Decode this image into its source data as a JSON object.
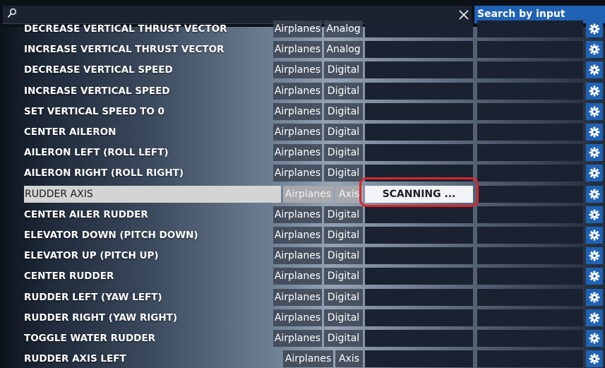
{
  "search": {
    "value": "",
    "placeholder": ""
  },
  "search_by_input_label": "Search by input",
  "rows": [
    {
      "name": "DECREASE VERTICAL THRUST VECTOR",
      "category": "Airplanes",
      "type": "Analog"
    },
    {
      "name": "INCREASE VERTICAL THRUST VECTOR",
      "category": "Airplanes",
      "type": "Analog"
    },
    {
      "name": "DECREASE VERTICAL SPEED",
      "category": "Airplanes",
      "type": "Digital"
    },
    {
      "name": "INCREASE VERTICAL SPEED",
      "category": "Airplanes",
      "type": "Digital"
    },
    {
      "name": "SET VERTICAL SPEED TO 0",
      "category": "Airplanes",
      "type": "Digital"
    },
    {
      "name": "CENTER AILERON",
      "category": "Airplanes",
      "type": "Digital"
    },
    {
      "name": "AILERON LEFT (ROLL LEFT)",
      "category": "Airplanes",
      "type": "Digital"
    },
    {
      "name": "AILERON RIGHT (ROLL RIGHT)",
      "category": "Airplanes",
      "type": "Digital"
    },
    {
      "name": "RUDDER AXIS",
      "category": "Airplanes",
      "type": "Axis",
      "binding": "SCANNING ..."
    },
    {
      "name": "CENTER AILER RUDDER",
      "category": "Airplanes",
      "type": "Digital"
    },
    {
      "name": "ELEVATOR DOWN (PITCH DOWN)",
      "category": "Airplanes",
      "type": "Digital"
    },
    {
      "name": "ELEVATOR UP (PITCH UP)",
      "category": "Airplanes",
      "type": "Digital"
    },
    {
      "name": "CENTER RUDDER",
      "category": "Airplanes",
      "type": "Digital"
    },
    {
      "name": "RUDDER LEFT (YAW LEFT)",
      "category": "Airplanes",
      "type": "Digital"
    },
    {
      "name": "RUDDER RIGHT (YAW RIGHT)",
      "category": "Airplanes",
      "type": "Digital"
    },
    {
      "name": "TOGGLE WATER RUDDER",
      "category": "Airplanes",
      "type": "Digital"
    },
    {
      "name": "RUDDER AXIS LEFT",
      "category": "Airplanes",
      "type": "Axis"
    }
  ],
  "colors": {
    "accent": "#1f62b4",
    "highlight_outline": "#d9262c"
  },
  "icons": {
    "search": "search-icon",
    "clear": "close-icon",
    "settings": "gear-icon"
  }
}
